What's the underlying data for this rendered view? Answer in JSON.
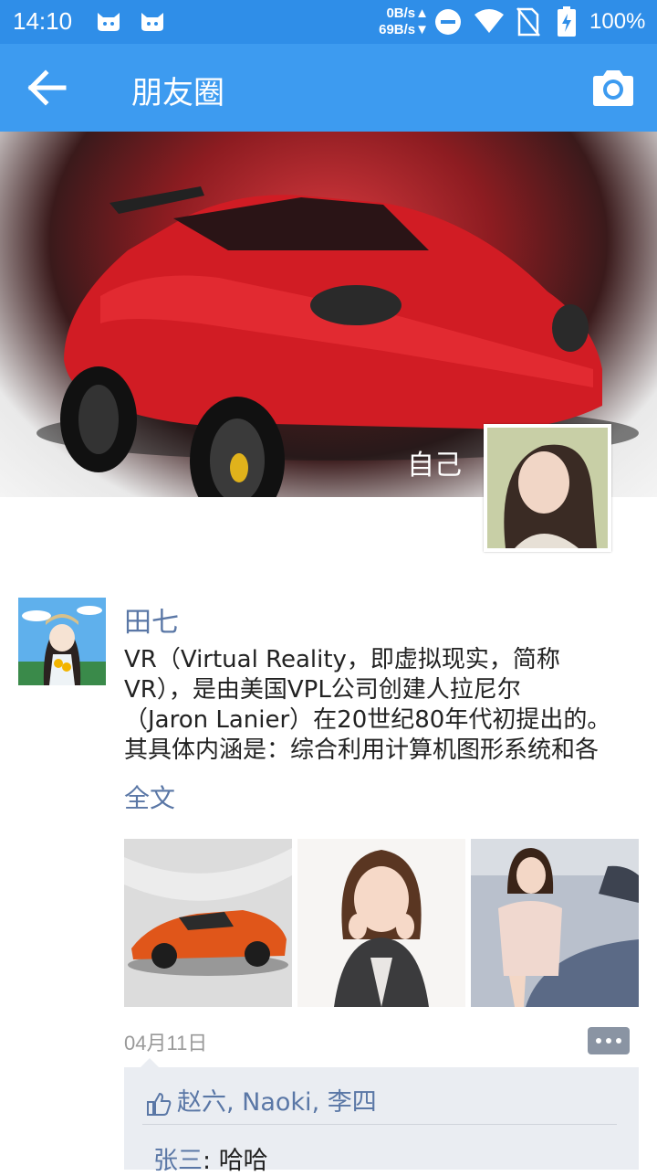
{
  "status_bar": {
    "time": "14:10",
    "net_up": "0B/s",
    "net_down": "69B/s",
    "battery": "100%",
    "icons": [
      "cat-notification-icon",
      "cat-notification-icon",
      "do-not-disturb-icon",
      "wifi-icon",
      "no-sim-icon",
      "battery-charging-icon"
    ]
  },
  "toolbar": {
    "title": "朋友圈",
    "back_icon": "arrow-left-icon",
    "camera_icon": "camera-icon"
  },
  "cover": {
    "self_label": "自己"
  },
  "post": {
    "author": "田七",
    "text": "VR（Virtual Reality，即虚拟现实，简称\nVR），是由美国VPL公司创建人拉尼尔\n（Jaron Lanier）在20世纪80年代初提出的。\n其具体内涵是：综合利用计算机图形系统和各",
    "more_label": "全文",
    "date": "04月11日",
    "likes": "赵六, Naoki, 李四",
    "comments": [
      {
        "author": "张三",
        "separator": ": ",
        "text": "哈哈"
      }
    ]
  },
  "colors": {
    "status_bar": "#2f8ee8",
    "toolbar": "#3d9bf0",
    "name_link": "#5a77a6",
    "comment_bg": "#eaedf2"
  }
}
